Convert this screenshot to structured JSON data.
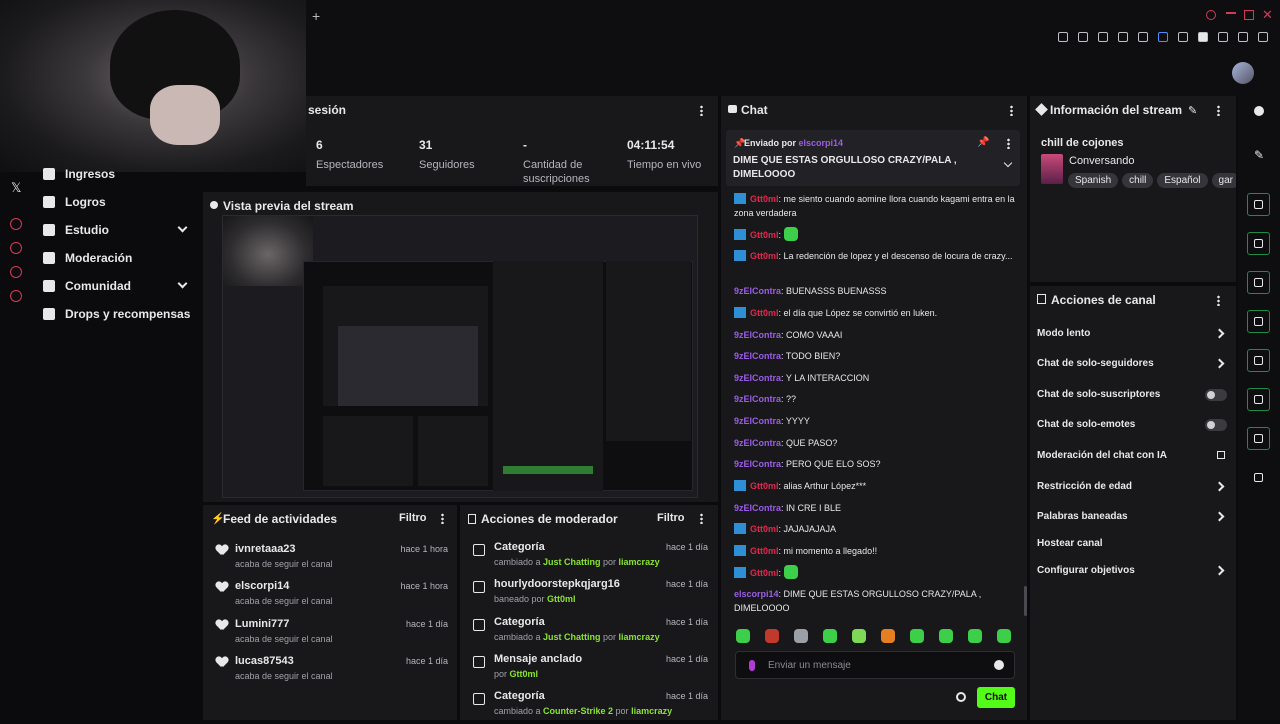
{
  "topbar": {
    "new_tab_glyph": "+"
  },
  "nav": {
    "items": [
      {
        "label": "Ingresos",
        "icon": "dollar-icon",
        "expandable": false
      },
      {
        "label": "Logros",
        "icon": "trophy-icon",
        "expandable": false
      },
      {
        "label": "Estudio",
        "icon": "camera-icon",
        "expandable": true
      },
      {
        "label": "Moderación",
        "icon": "sword-icon",
        "expandable": false
      },
      {
        "label": "Comunidad",
        "icon": "people-icon",
        "expandable": true
      },
      {
        "label": "Drops y recompensas",
        "icon": "gift-icon",
        "expandable": false
      }
    ],
    "x_glyph": "𝕏"
  },
  "session": {
    "title": "sesión",
    "stats": [
      {
        "value": "6",
        "label": "Espectadores"
      },
      {
        "value": "31",
        "label": "Seguidores"
      },
      {
        "value": "-",
        "label": "Cantidad de suscripciones"
      },
      {
        "value": "04:11:54",
        "label": "Tiempo en vivo"
      }
    ]
  },
  "preview": {
    "title": "Vista previa del stream"
  },
  "feed": {
    "title": "Feed de actividades",
    "filter": "Filtro",
    "rows": [
      {
        "name": "ivnretaaa23",
        "sub": "acaba de seguir el canal",
        "time": "hace 1 hora"
      },
      {
        "name": "elscorpi14",
        "sub": "acaba de seguir el canal",
        "time": "hace 1 hora"
      },
      {
        "name": "Lumini777",
        "sub": "acaba de seguir el canal",
        "time": "hace 1 día"
      },
      {
        "name": "lucas87543",
        "sub": "acaba de seguir el canal",
        "time": "hace 1 día"
      }
    ]
  },
  "modactions": {
    "title": "Acciones de moderador",
    "filter": "Filtro",
    "rows": [
      {
        "name": "Categoría",
        "sub_pre": "cambiado a ",
        "sub_hl": "Just Chatting",
        "sub_mid": " por ",
        "sub_user": "liamcrazy",
        "time": "hace 1 día",
        "icon": "category-icon"
      },
      {
        "name": "hourlydoorstepkqjarg16",
        "sub_pre": "baneado por ",
        "sub_hl": "",
        "sub_mid": "",
        "sub_user": "Gtt0ml",
        "time": "hace 1 día",
        "icon": "ban-icon"
      },
      {
        "name": "Categoría",
        "sub_pre": "cambiado a ",
        "sub_hl": "Just Chatting",
        "sub_mid": " por ",
        "sub_user": "liamcrazy",
        "time": "hace 1 día",
        "icon": "category-icon"
      },
      {
        "name": "Mensaje anclado",
        "sub_pre": "por ",
        "sub_hl": "",
        "sub_mid": "",
        "sub_user": "Gtt0ml",
        "time": "hace 1 día",
        "icon": "pin-icon"
      },
      {
        "name": "Categoría",
        "sub_pre": "cambiado a ",
        "sub_hl": "Counter-Strike 2",
        "sub_mid": " por ",
        "sub_user": "liamcrazy",
        "time": "hace 1 día",
        "icon": "category-icon"
      }
    ]
  },
  "chat": {
    "title": "Chat",
    "pinned_by_label": "Enviado por ",
    "pinned_by_user": "elscorpi14",
    "pinned_text": "DIME QUE ESTAS ORGULLOSO CRAZY/PALA , DIMELOOOO",
    "messages": [
      {
        "user": "Gtt0ml",
        "color": "r",
        "badge": true,
        "text": "me siento cuando aomine llora cuando kagami entra en la zona verdadera"
      },
      {
        "user": "Gtt0ml",
        "color": "r",
        "badge": true,
        "text": "",
        "emote": true
      },
      {
        "user": "Gtt0ml",
        "color": "r",
        "badge": true,
        "text": "La redención de lopez y el descenso de locura de crazy..."
      },
      {
        "user": "9zElContra",
        "color": "p",
        "badge": false,
        "text": "BUENASSS BUENASSS"
      },
      {
        "user": "Gtt0ml",
        "color": "r",
        "badge": true,
        "text": "el día que López se convirtió en luken."
      },
      {
        "user": "9zElContra",
        "color": "p",
        "badge": false,
        "text": "COMO VAAAI"
      },
      {
        "user": "9zElContra",
        "color": "p",
        "badge": false,
        "text": "TODO BIEN?"
      },
      {
        "user": "9zElContra",
        "color": "p",
        "badge": false,
        "text": "Y LA INTERACCION"
      },
      {
        "user": "9zElContra",
        "color": "p",
        "badge": false,
        "text": "??"
      },
      {
        "user": "9zElContra",
        "color": "p",
        "badge": false,
        "text": "YYYY"
      },
      {
        "user": "9zElContra",
        "color": "p",
        "badge": false,
        "text": "QUE PASO?"
      },
      {
        "user": "9zElContra",
        "color": "p",
        "badge": false,
        "text": "PERO QUE ELO SOS?"
      },
      {
        "user": "Gtt0ml",
        "color": "r",
        "badge": true,
        "text": "alias Arthur López***"
      },
      {
        "user": "9zElContra",
        "color": "p",
        "badge": false,
        "text": "IN CRE I BLE"
      },
      {
        "user": "Gtt0ml",
        "color": "r",
        "badge": true,
        "text": "JAJAJAJAJA"
      },
      {
        "user": "Gtt0ml",
        "color": "r",
        "badge": true,
        "text": "mi momento a llegado!!"
      },
      {
        "user": "Gtt0ml",
        "color": "r",
        "badge": true,
        "text": "",
        "emote": true
      },
      {
        "user": "elscorpi14",
        "color": "p",
        "badge": false,
        "text": "DIME QUE ESTAS ORGULLOSO CRAZY/PALA , DIMELOOOO"
      }
    ],
    "emote_count": 10,
    "input_placeholder": "Enviar un mensaje",
    "send_label": "Chat"
  },
  "streaminfo": {
    "title": "Información del stream",
    "stream_title": "chill de cojones",
    "category": "Conversando",
    "tags": [
      "Spanish",
      "chill",
      "Español",
      "gar"
    ]
  },
  "channelactions": {
    "title": "Acciones de canal",
    "items": [
      {
        "label": "Modo lento",
        "control": "chevron"
      },
      {
        "label": "Chat de solo-seguidores",
        "control": "chevron"
      },
      {
        "label": "Chat de solo-suscriptores",
        "control": "toggle"
      },
      {
        "label": "Chat de solo-emotes",
        "control": "toggle"
      },
      {
        "label": "Moderación del chat con IA",
        "control": "external"
      },
      {
        "label": "Restricción de edad",
        "control": "chevron"
      },
      {
        "label": "Palabras baneadas",
        "control": "chevron"
      },
      {
        "label": "Hostear canal",
        "control": "none"
      },
      {
        "label": "Configurar objetivos",
        "control": "chevron"
      }
    ]
  },
  "colors": {
    "accent_green": "#53fc18",
    "username_red": "#e0284e",
    "username_purple": "#9b5de5",
    "panel": "#18181b"
  }
}
